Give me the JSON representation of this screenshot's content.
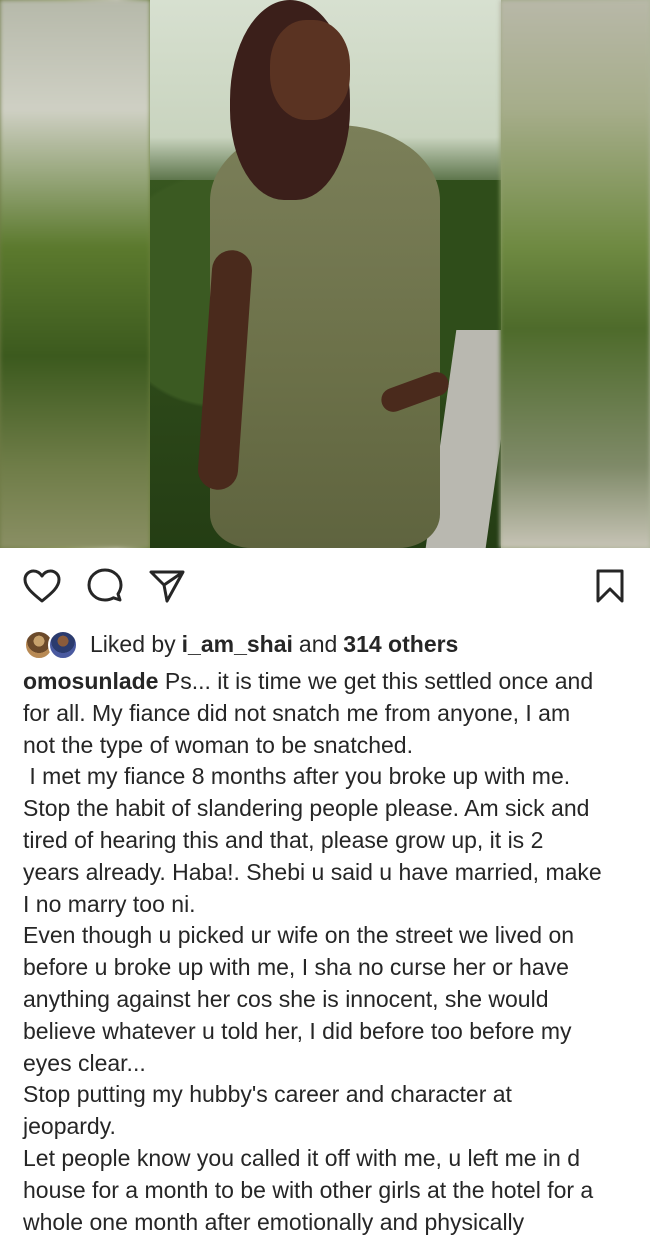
{
  "post": {
    "liked_by": {
      "prefix": "Liked by",
      "user": "i_am_shai",
      "conjunction": "and",
      "others": "314 others"
    },
    "caption": {
      "username": "omosunlade",
      "first_line": "Ps... it is time we get this settled once and",
      "lines": [
        "for all. My fiance did not snatch me from anyone, I am",
        "not the type of woman to be snatched.",
        " I met my fiance 8 months after you broke up with me.",
        "Stop the habit of slandering people please. Am sick and",
        "tired of hearing this and that, please grow up, it is 2",
        "years already. Haba!. Shebi u said u have married, make",
        "I no marry too ni.",
        "Even though u picked ur wife on the street we lived on",
        "before u broke up with me, I sha no curse her or have",
        "anything against her cos she is innocent, she would",
        "believe whatever u told her, I did before too before my",
        "eyes clear...",
        "Stop putting my hubby's career and character at",
        "jeopardy.",
        "Let people know you called it off with me, u left me in d",
        "house for a month to be with other girls at the hotel for a",
        "whole one month after emotionally and physically"
      ]
    },
    "icons": {
      "like": "heart-icon",
      "comment": "comment-icon",
      "share": "send-icon",
      "save": "bookmark-icon"
    }
  }
}
